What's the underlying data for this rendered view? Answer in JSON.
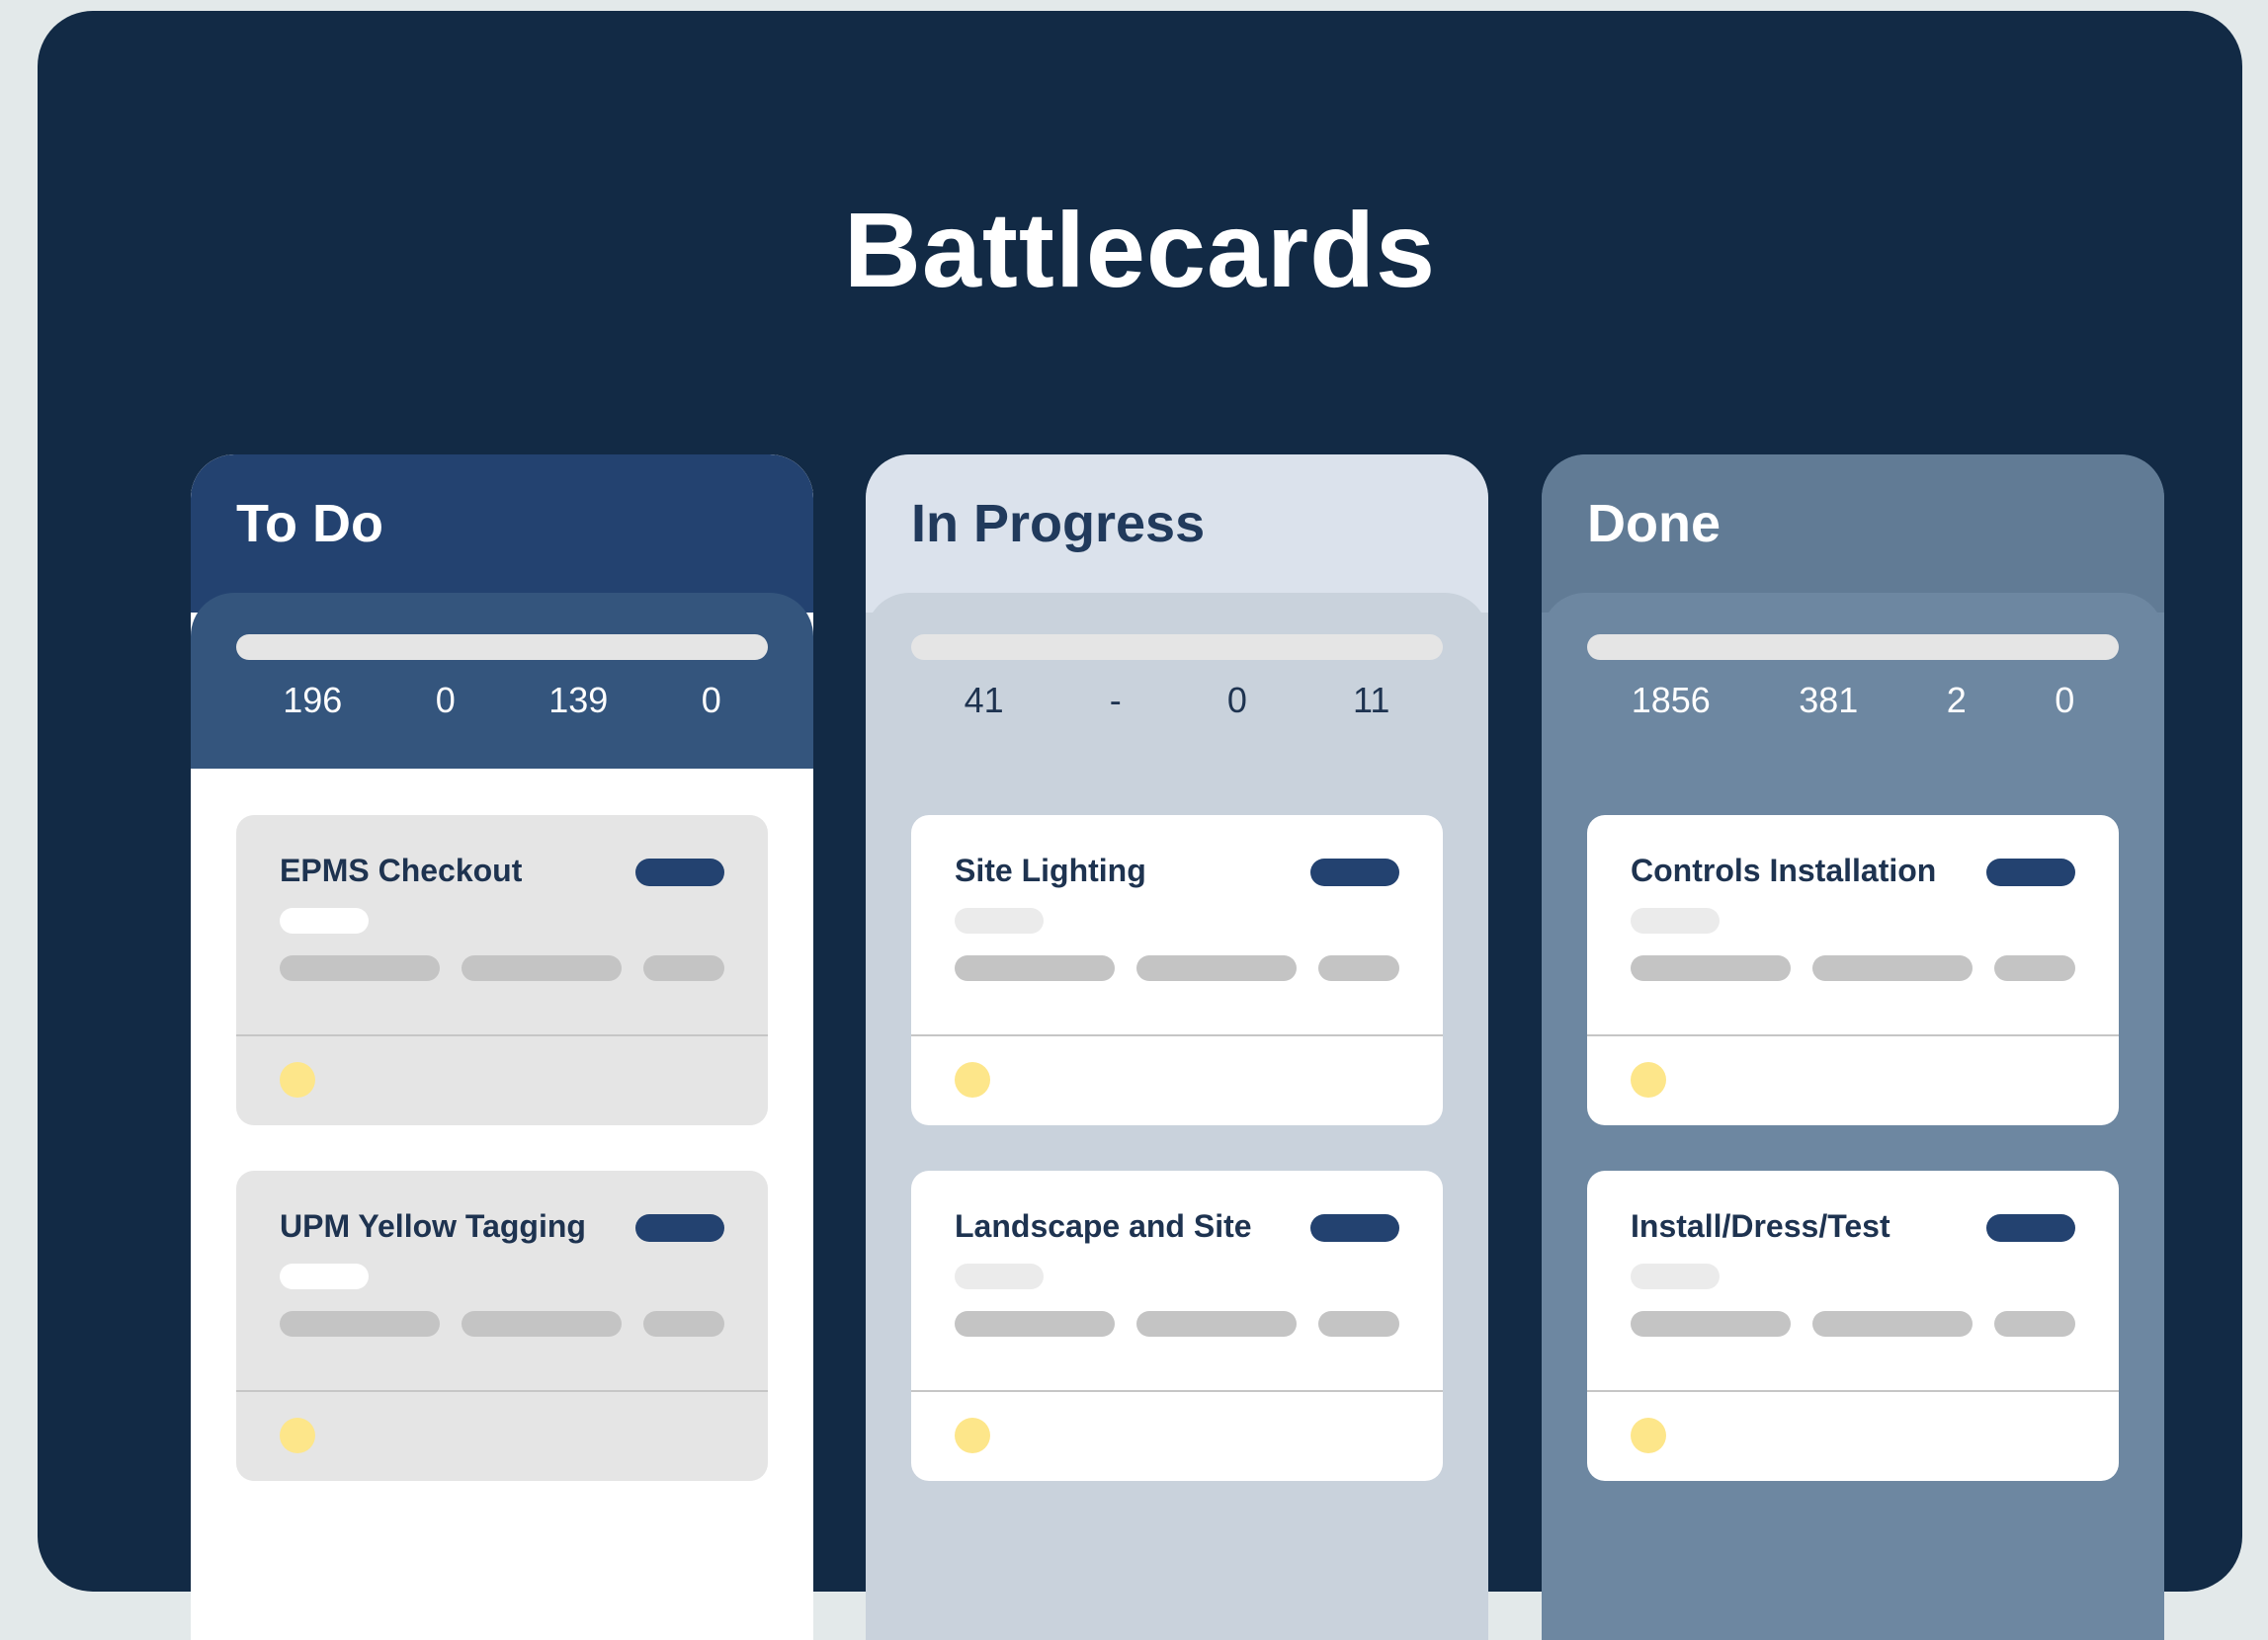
{
  "board": {
    "title": "Battlecards"
  },
  "columns": [
    {
      "title": "To Do",
      "stats": [
        "196",
        "0",
        "139",
        "0"
      ],
      "cards": [
        {
          "title": "EPMS Checkout"
        },
        {
          "title": "UPM Yellow Tagging"
        }
      ]
    },
    {
      "title": "In Progress",
      "stats": [
        "41",
        "-",
        "0",
        "11"
      ],
      "cards": [
        {
          "title": "Site Lighting"
        },
        {
          "title": "Landscape and Site"
        }
      ]
    },
    {
      "title": "Done",
      "stats": [
        "1856",
        "381",
        "2",
        "0"
      ],
      "cards": [
        {
          "title": "Controls Installation"
        },
        {
          "title": "Install/Dress/Test"
        }
      ]
    }
  ],
  "colors": {
    "board_bg": "#122a45",
    "todo_header": "#234270",
    "in_progress_header": "#dbe2ec",
    "done_header": "#617b95",
    "tag": "#234270",
    "status_dot": "#fde68a"
  }
}
